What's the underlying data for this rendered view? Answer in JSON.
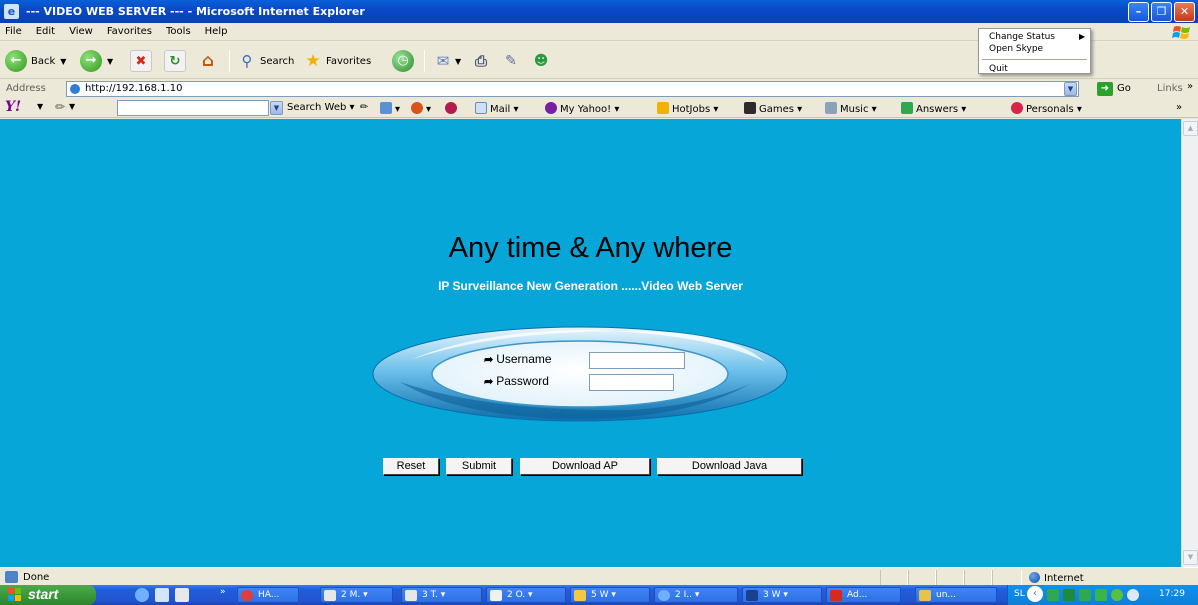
{
  "window": {
    "title": "--- VIDEO WEB SERVER --- - Microsoft Internet Explorer"
  },
  "menu": [
    "File",
    "Edit",
    "View",
    "Favorites",
    "Tools",
    "Help"
  ],
  "toolbar": {
    "back_label": "Back",
    "search_label": "Search",
    "favorites_label": "Favorites"
  },
  "address": {
    "label": "Address",
    "url": "http://192.168.1.10",
    "go_label": "Go",
    "links_label": "Links"
  },
  "yahoo_toolbar": {
    "logo": "Y!",
    "search_button": "Search Web",
    "items": [
      "Mail",
      "My Yahoo!",
      "HotJobs",
      "Games",
      "Music",
      "Answers",
      "Personals"
    ]
  },
  "context_menu": {
    "change_status": "Change Status",
    "open_skype": "Open Skype",
    "quit": "Quit"
  },
  "page": {
    "headline": "Any time & Any where",
    "subline": "IP Surveillance New Generation ......Video Web Server",
    "username_label": "Username",
    "password_label": "Password",
    "buttons": {
      "reset": "Reset",
      "submit": "Submit",
      "download_ap": "Download AP",
      "download_java": "Download Java"
    }
  },
  "status": {
    "text": "Done",
    "zone": "Internet"
  },
  "taskbar": {
    "start_label": "start",
    "tasks": [
      "HA...",
      "2 M.",
      "3 T.",
      "2 O.",
      "5 W",
      "2 I..",
      "3 W",
      "Ad...",
      "un..."
    ],
    "tray_text": "SL",
    "clock": "17:29"
  },
  "colors": {
    "page_background": "#06a7d8",
    "title_bar": "#0a48c5",
    "taskbar": "#245edb",
    "start_button": "#3a9a3a"
  }
}
